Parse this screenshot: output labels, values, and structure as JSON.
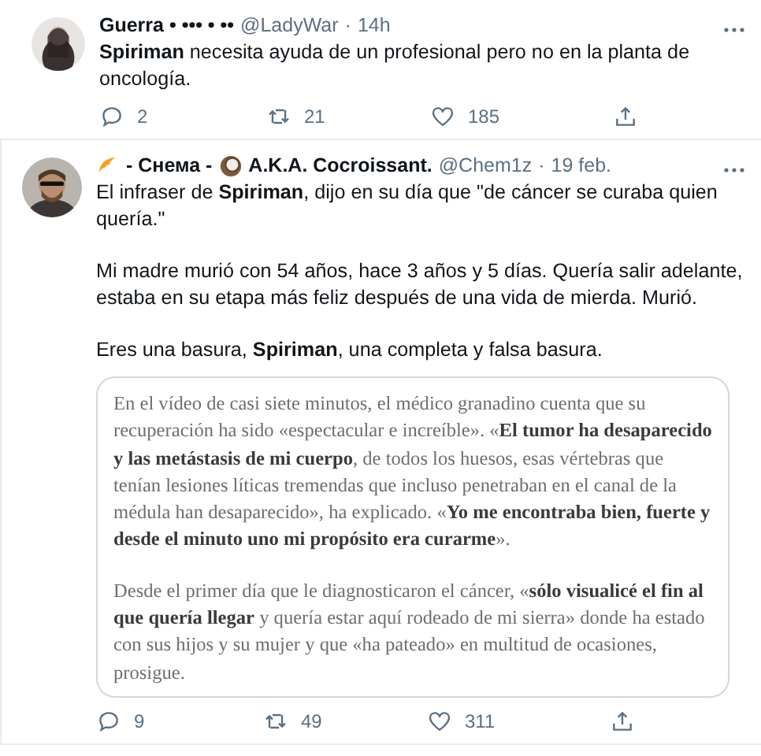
{
  "tweets": [
    {
      "avatar": {
        "kind": "picture"
      },
      "name_parts": [
        {
          "kind": "text",
          "text": "Guerra • ••• • ••"
        }
      ],
      "handle": "@LadyWar",
      "separator": "·",
      "time": "14h",
      "paragraphs": [
        "**Spiriman** necesita ayuda de un profesional pero no en la planta de oncología."
      ],
      "counts": {
        "replies": "2",
        "retweets": "21",
        "likes": "185"
      }
    },
    {
      "avatar": {
        "kind": "picture"
      },
      "name_parts": [
        {
          "kind": "croissant"
        },
        {
          "kind": "text",
          "text": "- Снема -"
        },
        {
          "kind": "coconut"
        },
        {
          "kind": "text",
          "text": "A.K.A. Cocroissant."
        }
      ],
      "handle": "@Chem1z",
      "separator": "·",
      "time": "19 feb.",
      "paragraphs": [
        "El infraser de **Spiriman**, dijo en su día que \"de cáncer se curaba quien quería.\"",
        "Mi madre murió con 54 años, hace 3 años y 5 días. Quería salir adelante, estaba en su etapa más feliz después de una vida de mierda. Murió.",
        "Eres una basura, **Spiriman**, una completa y falsa basura."
      ],
      "quote": {
        "paragraphs": [
          "En el vídeo de casi siete minutos, el médico granadino cuenta que su recuperación ha sido «espectacular e increíble». «**El tumor ha desaparecido y las metástasis de mi cuerpo**, de todos los huesos, esas vértebras que tenían lesiones líticas tremendas que incluso penetraban en el canal de la médula han desaparecido», ha explicado. «**Yo me encontraba bien, fuerte y desde el minuto uno mi propósito era curarme**».",
          "Desde el primer día que le diagnosticaron el cáncer, «**sólo visualicé el fin al que quería llegar** y quería estar aquí rodeado de mi sierra» donde ha estado con sus hijos y su mujer y que «ha pateado» en multitud de ocasiones, prosigue."
        ]
      },
      "counts": {
        "replies": "9",
        "retweets": "49",
        "likes": "311"
      }
    }
  ]
}
